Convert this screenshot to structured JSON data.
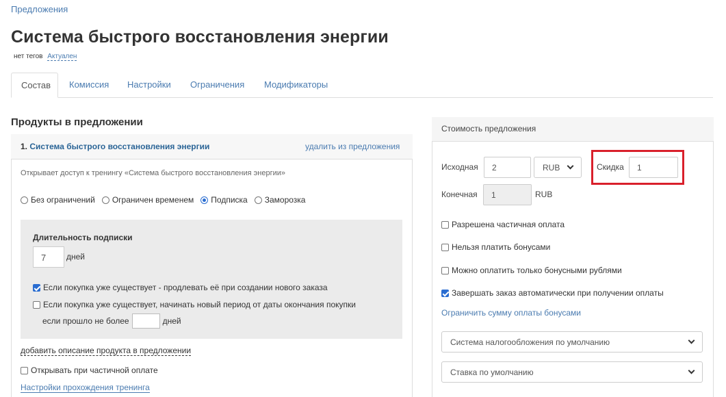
{
  "breadcrumb": "Предложения",
  "page_title": "Система быстрого восстановления энергии",
  "tags": {
    "no_tags": "нет тегов",
    "status": "Актуален"
  },
  "tabs": [
    {
      "label": "Состав",
      "active": true
    },
    {
      "label": "Комиссия"
    },
    {
      "label": "Настройки"
    },
    {
      "label": "Ограничения"
    },
    {
      "label": "Модификаторы"
    }
  ],
  "products": {
    "section_title": "Продукты в предложении",
    "item": {
      "number": "1.",
      "name": "Система быстрого восстановления энергии",
      "remove_label": "удалить из предложения",
      "description": "Открывает доступ к тренингу «Система быстрого восстановления энергии»",
      "access_options": [
        {
          "label": "Без ограничений",
          "checked": false
        },
        {
          "label": "Ограничен временем",
          "checked": false
        },
        {
          "label": "Подписка",
          "checked": true
        },
        {
          "label": "Заморозка",
          "checked": false
        }
      ],
      "subscription": {
        "title": "Длительность подписки",
        "days_value": "7",
        "days_unit": "дней",
        "extend_label": "Если покупка уже существует - продлевать её при создании нового заказа",
        "extend_checked": true,
        "new_period_label_1": "Если покупка уже существует, начинать новый период от даты окончания покупки",
        "new_period_label_2a": "если прошло не более",
        "new_period_label_2b": "дней",
        "new_period_value": "",
        "new_period_checked": false
      },
      "add_description_label": "добавить описание продукта в предложении",
      "open_on_partial_label": "Открывать при частичной оплате",
      "open_on_partial_checked": false,
      "training_settings_link": "Настройки прохождения тренинга"
    }
  },
  "cost": {
    "title": "Стоимость предложения",
    "original_label": "Исходная",
    "original_value": "2",
    "currency": "RUB",
    "discount_label": "Скидка",
    "discount_value": "1",
    "final_label": "Конечная",
    "final_value": "1",
    "final_currency": "RUB",
    "options": [
      {
        "label": "Разрешена частичная оплата",
        "checked": false
      },
      {
        "label": "Нельзя платить бонусами",
        "checked": false
      },
      {
        "label": "Можно оплатить только бонусными рублями",
        "checked": false
      },
      {
        "label": "Завершать заказ автоматически при получении оплаты",
        "checked": true
      }
    ],
    "limit_bonus_link": "Ограничить сумму оплаты бонусами",
    "tax_system": "Система налогообложения по умолчанию",
    "tax_rate": "Ставка по умолчанию"
  },
  "colors": {
    "link": "#2a6496",
    "highlight": "#d9202b",
    "checkbox": "#2a6dd1"
  }
}
